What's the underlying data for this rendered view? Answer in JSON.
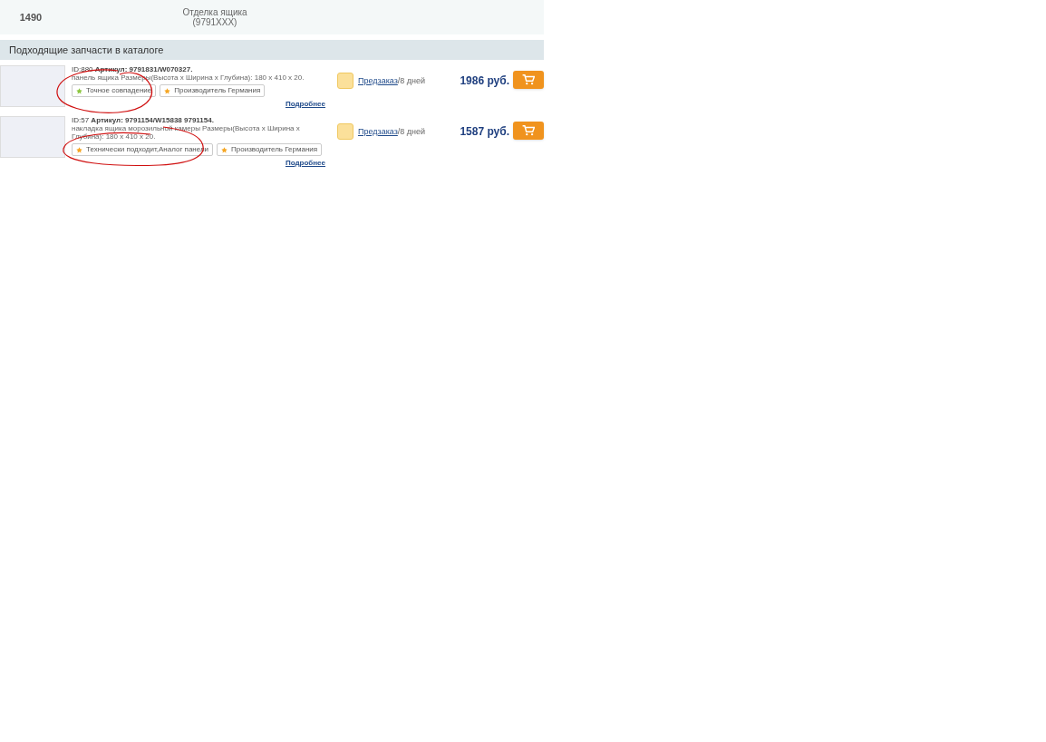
{
  "summary_row": {
    "number": "1490",
    "name": "Отделка ящика",
    "code": "(9791XXX)"
  },
  "catalog": {
    "heading": "Подходящие запчасти в каталоге",
    "items": [
      {
        "id": "ID:880",
        "article": "Артикул: 9791831/W070327.",
        "description": "панель ящика Размеры(Высота х Ширина х Глубина): 180 х 410 х 20.",
        "tags": [
          {
            "label": "Точное совпадение",
            "color": "#8cc63f"
          },
          {
            "label": "Производитель Германия",
            "color": "#f5a623"
          }
        ],
        "more": "Подробнее",
        "availability_link": "Предзаказ",
        "availability_note": "/8 дней",
        "price": "1986 руб."
      },
      {
        "id": "ID:57",
        "article": "Артикул: 9791154/W15838 9791154.",
        "description": "накладка ящика морозильной камеры Размеры(Высота х Ширина х Глубина): 180 х 410 х 20.",
        "tags": [
          {
            "label": "Технически подходит,Аналог панели",
            "color": "#f5a623"
          },
          {
            "label": "Производитель Германия",
            "color": "#f5a623"
          }
        ],
        "more": "Подробнее",
        "availability_link": "Предзаказ",
        "availability_note": "/8 дней",
        "price": "1587 руб."
      }
    ]
  }
}
